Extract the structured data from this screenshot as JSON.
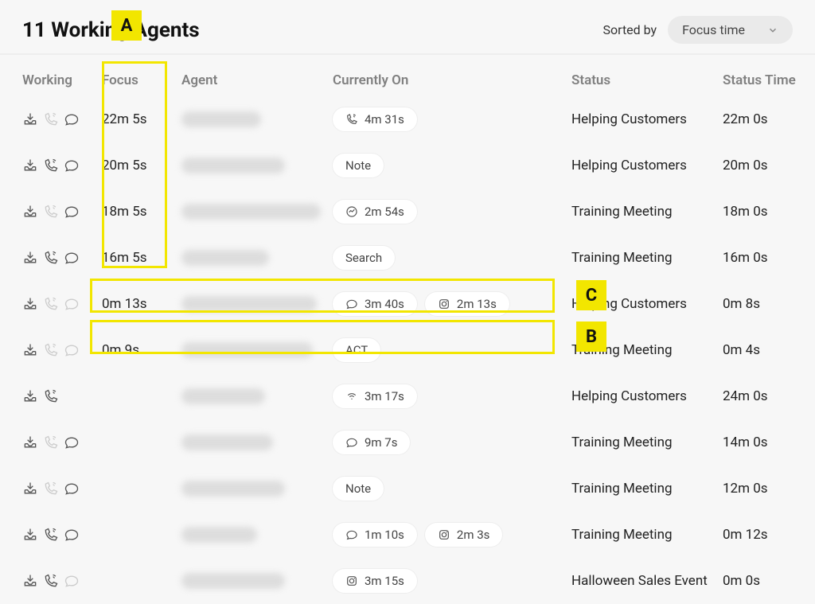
{
  "header": {
    "title": "11 Working Agents",
    "sorted_by_label": "Sorted by",
    "sort_value": "Focus time"
  },
  "columns": {
    "working": "Working",
    "focus": "Focus",
    "agent": "Agent",
    "currently_on": "Currently On",
    "status": "Status",
    "status_time": "Status Time"
  },
  "icons": {
    "inbox": "inbox-icon",
    "phone": "phone-icon",
    "chat": "chat-icon",
    "messenger": "messenger-icon",
    "instagram": "instagram-icon",
    "wifi": "wifi-icon"
  },
  "rows": [
    {
      "working": [
        "inbox-active",
        "phone-dim",
        "chat-active"
      ],
      "focus": "22m 5s",
      "agent_blur_w": 100,
      "currently": [
        {
          "icon": "phone",
          "text": "4m 31s"
        }
      ],
      "status": "Helping Customers",
      "status_time": "22m 0s"
    },
    {
      "working": [
        "inbox-active",
        "phone-active",
        "chat-active"
      ],
      "focus": "20m 5s",
      "agent_blur_w": 130,
      "currently": [
        {
          "icon": "",
          "text": "Note"
        }
      ],
      "status": "Helping Customers",
      "status_time": "20m 0s"
    },
    {
      "working": [
        "inbox-active",
        "phone-dim",
        "chat-active"
      ],
      "focus": "18m 5s",
      "agent_blur_w": 175,
      "currently": [
        {
          "icon": "messenger",
          "text": "2m 54s"
        }
      ],
      "status": "Training Meeting",
      "status_time": "18m 0s"
    },
    {
      "working": [
        "inbox-active",
        "phone-active",
        "chat-active"
      ],
      "focus": "16m 5s",
      "agent_blur_w": 110,
      "currently": [
        {
          "icon": "",
          "text": "Search"
        }
      ],
      "status": "Training Meeting",
      "status_time": "16m 0s"
    },
    {
      "working": [
        "inbox-active",
        "phone-dim",
        "chat-dim"
      ],
      "focus": "0m 13s",
      "agent_blur_w": 170,
      "currently": [
        {
          "icon": "chat",
          "text": "3m 40s"
        },
        {
          "icon": "instagram",
          "text": "2m 13s"
        }
      ],
      "status": "Helping Customers",
      "status_time": "0m 8s"
    },
    {
      "working": [
        "inbox-active",
        "phone-dim",
        "chat-dim"
      ],
      "focus": "0m 9s",
      "agent_blur_w": 165,
      "currently": [
        {
          "icon": "",
          "text": "ACT"
        }
      ],
      "status": "Training Meeting",
      "status_time": "0m 4s"
    },
    {
      "working": [
        "inbox-active",
        "phone-active"
      ],
      "focus": "",
      "agent_blur_w": 105,
      "currently": [
        {
          "icon": "wifi",
          "text": "3m 17s"
        }
      ],
      "status": "Helping Customers",
      "status_time": "24m 0s"
    },
    {
      "working": [
        "inbox-active",
        "phone-dim",
        "chat-active"
      ],
      "focus": "",
      "agent_blur_w": 115,
      "currently": [
        {
          "icon": "chat",
          "text": "9m 7s"
        }
      ],
      "status": "Training Meeting",
      "status_time": "14m 0s"
    },
    {
      "working": [
        "inbox-active",
        "phone-dim",
        "chat-active"
      ],
      "focus": "",
      "agent_blur_w": 130,
      "currently": [
        {
          "icon": "",
          "text": "Note"
        }
      ],
      "status": "Training Meeting",
      "status_time": "12m 0s"
    },
    {
      "working": [
        "inbox-active",
        "phone-active",
        "chat-active"
      ],
      "focus": "",
      "agent_blur_w": 95,
      "currently": [
        {
          "icon": "chat",
          "text": "1m 10s"
        },
        {
          "icon": "instagram",
          "text": "2m 3s"
        }
      ],
      "status": "Training Meeting",
      "status_time": "0m 12s"
    },
    {
      "working": [
        "inbox-active",
        "phone-active",
        "chat-dim"
      ],
      "focus": "",
      "agent_blur_w": 130,
      "currently": [
        {
          "icon": "instagram",
          "text": "3m 15s"
        }
      ],
      "status": "Halloween Sales Event",
      "status_time": "0m 0s"
    }
  ],
  "annotations": {
    "A": "A",
    "B": "B",
    "C": "C"
  }
}
